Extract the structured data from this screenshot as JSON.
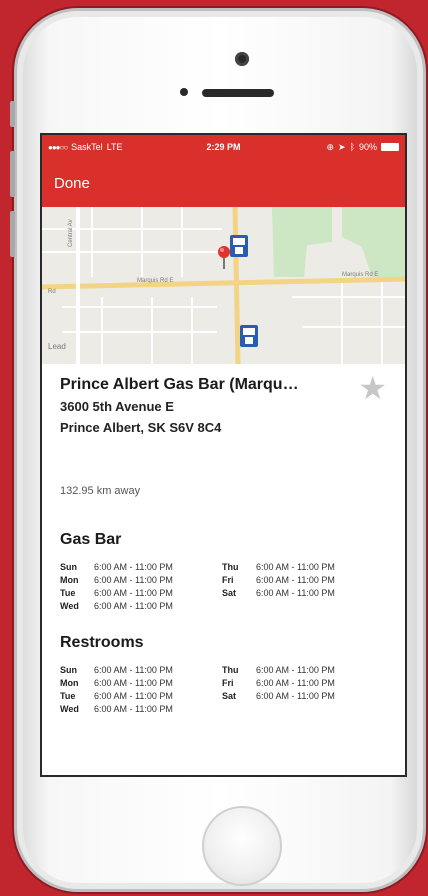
{
  "status_bar": {
    "carrier": "SaskTel",
    "network": "LTE",
    "time": "2:29 PM",
    "battery": "90%"
  },
  "nav": {
    "done_label": "Done"
  },
  "map": {
    "road_labels": [
      "Marquis Rd E",
      "Marquis Rd E",
      "Central Av",
      "Rd",
      "Lead"
    ]
  },
  "station": {
    "name": "Prince Albert Gas Bar (Marqu…",
    "address_line1": "3600 5th Avenue E",
    "address_line2": "Prince Albert, SK S6V 8C4",
    "distance": "132.95 km away"
  },
  "sections": [
    {
      "title": "Gas Bar",
      "left": [
        {
          "day": "Sun",
          "time": "6:00 AM - 11:00 PM"
        },
        {
          "day": "Mon",
          "time": "6:00 AM - 11:00 PM"
        },
        {
          "day": "Tue",
          "time": "6:00 AM - 11:00 PM"
        },
        {
          "day": "Wed",
          "time": "6:00 AM - 11:00 PM"
        }
      ],
      "right": [
        {
          "day": "Thu",
          "time": "6:00 AM - 11:00 PM"
        },
        {
          "day": "Fri",
          "time": "6:00 AM - 11:00 PM"
        },
        {
          "day": "Sat",
          "time": "6:00 AM - 11:00 PM"
        }
      ]
    },
    {
      "title": "Restrooms",
      "left": [
        {
          "day": "Sun",
          "time": "6:00 AM - 11:00 PM"
        },
        {
          "day": "Mon",
          "time": "6:00 AM - 11:00 PM"
        },
        {
          "day": "Tue",
          "time": "6:00 AM - 11:00 PM"
        },
        {
          "day": "Wed",
          "time": "6:00 AM - 11:00 PM"
        }
      ],
      "right": [
        {
          "day": "Thu",
          "time": "6:00 AM - 11:00 PM"
        },
        {
          "day": "Fri",
          "time": "6:00 AM - 11:00 PM"
        },
        {
          "day": "Sat",
          "time": "6:00 AM - 11:00 PM"
        }
      ]
    }
  ],
  "icons": {
    "favorite": "star-icon",
    "pin": "map-pin-icon",
    "station_marker": "gas-station-marker-icon"
  },
  "colors": {
    "background": "#c1262f",
    "nav_bar": "#d9302c",
    "star": "#c7c7c7"
  }
}
